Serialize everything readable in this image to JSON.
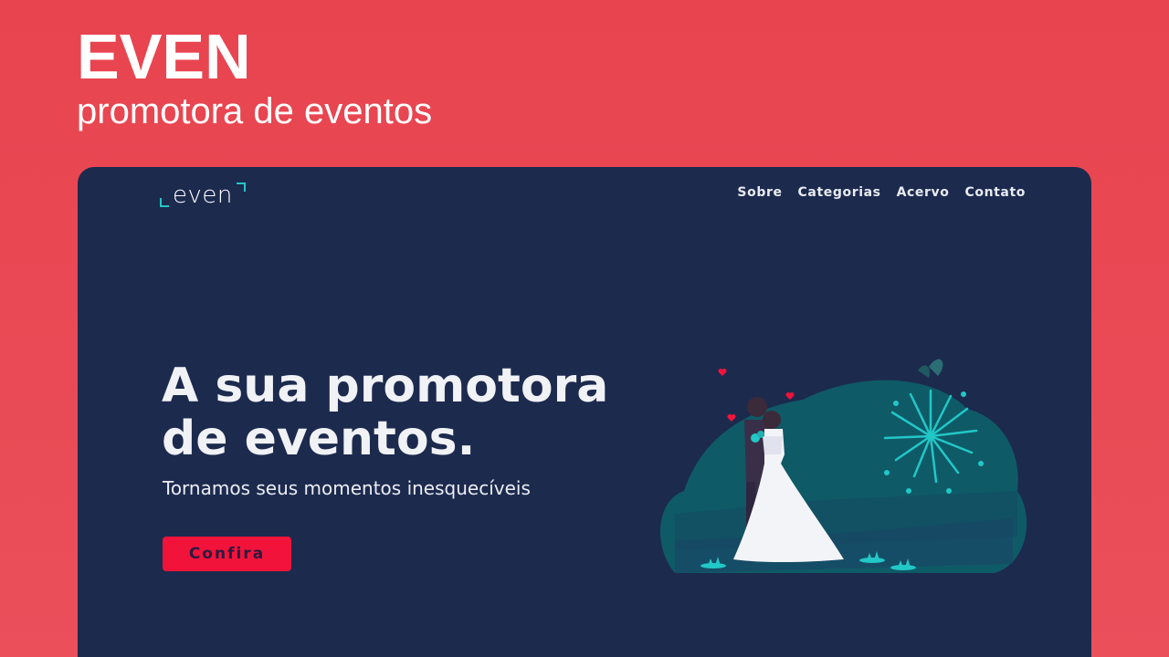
{
  "banner": {
    "title": "EVEN",
    "subtitle": "promotora de eventos"
  },
  "site": {
    "logo_text": "even",
    "nav": [
      "Sobre",
      "Categorias",
      "Acervo",
      "Contato"
    ],
    "hero": {
      "title": "A sua promotora de eventos.",
      "subtitle": "Tornamos seus momentos inesquecíveis",
      "cta_label": "Confira"
    }
  },
  "colors": {
    "banner_bg": "#e8444f",
    "site_bg": "#1c2a4e",
    "accent_teal": "#22c7c7",
    "cta_red": "#f2133b"
  },
  "icons": {
    "illustration": "wedding-couple-fireworks-illustration"
  }
}
